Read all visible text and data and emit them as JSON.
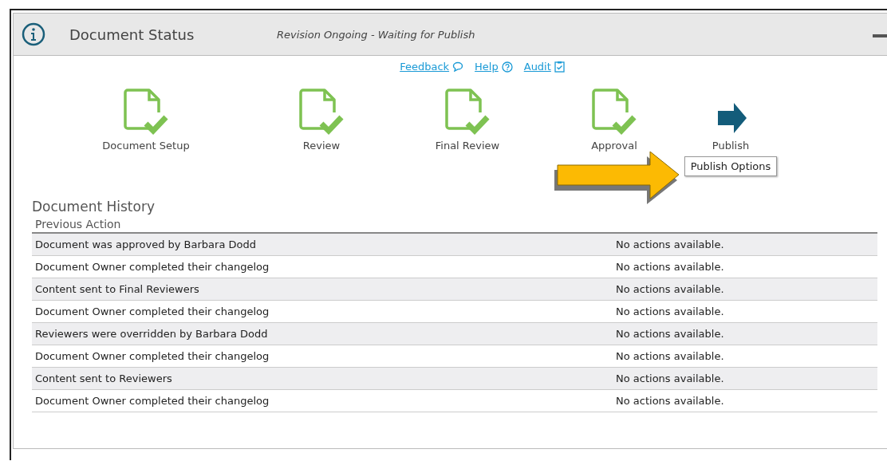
{
  "header": {
    "title": "Document Status",
    "status": "Revision Ongoing - Waiting for Publish"
  },
  "links": [
    {
      "label": "Feedback",
      "kind": "feedback"
    },
    {
      "label": "Help",
      "kind": "help"
    },
    {
      "label": "Audit",
      "kind": "audit"
    }
  ],
  "steps": [
    {
      "label": "Document Setup",
      "kind": "complete"
    },
    {
      "label": "Review",
      "kind": "complete"
    },
    {
      "label": "Final Review",
      "kind": "complete"
    },
    {
      "label": "Approval",
      "kind": "complete"
    },
    {
      "label": "Publish",
      "kind": "current",
      "tooltip": "Publish Options"
    }
  ],
  "history": {
    "title": "Document History",
    "columns": [
      "Previous Action"
    ],
    "rows": [
      [
        "Document was approved by Barbara Dodd",
        "No actions available."
      ],
      [
        "Document Owner completed their changelog",
        "No actions available."
      ],
      [
        "Content sent to Final Reviewers",
        "No actions available."
      ],
      [
        "Document Owner completed their changelog",
        "No actions available."
      ],
      [
        "Reviewers were overridden by Barbara Dodd",
        "No actions available."
      ],
      [
        "Document Owner completed their changelog",
        "No actions available."
      ],
      [
        "Content sent to Reviewers",
        "No actions available."
      ],
      [
        "Document Owner completed their changelog",
        "No actions available."
      ]
    ]
  }
}
